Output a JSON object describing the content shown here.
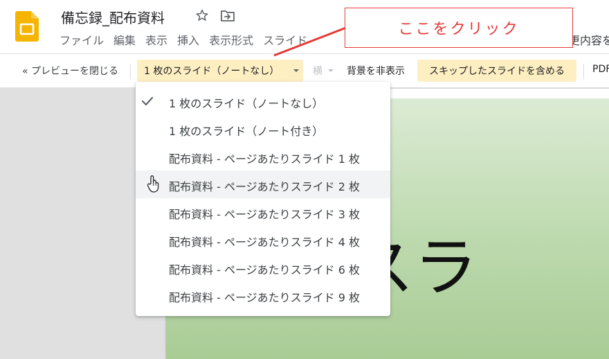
{
  "header": {
    "title": "備忘録_配布資料",
    "menu": [
      "ファイル",
      "編集",
      "表示",
      "挿入",
      "表示形式",
      "スライド"
    ],
    "right_cut_text": "更内容を"
  },
  "toolbar": {
    "close_preview": "« プレビューを閉じる",
    "layout_selected": "1 枚のスライド（ノートなし）",
    "orientation": "横",
    "hide_background": "背景を非表示",
    "include_skipped": "スキップしたスライドを含める",
    "pdf": "PDF"
  },
  "dropdown": {
    "options": [
      "1 枚のスライド（ノートなし）",
      "1 枚のスライド（ノート付き）",
      "配布資料 - ページあたりスライド 1 枚",
      "配布資料 - ページあたりスライド 2 枚",
      "配布資料 - ページあたりスライド 3 枚",
      "配布資料 - ページあたりスライド 4 枚",
      "配布資料 - ページあたりスライド 6 枚",
      "配布資料 - ページあたりスライド 9 枚"
    ],
    "checked_index": 0,
    "hovered_index": 3
  },
  "slide": {
    "text": "目のスラ"
  },
  "annotation": {
    "text": "ここをクリック"
  },
  "colors": {
    "highlight": "#feefc3",
    "annotation": "#e53935",
    "slides_yellow": "#f4b400"
  },
  "icons": {
    "app": "google-slides-icon",
    "star": "star-icon",
    "move": "move-to-folder-icon",
    "check": "check-icon",
    "cursor": "hand-cursor-icon"
  }
}
